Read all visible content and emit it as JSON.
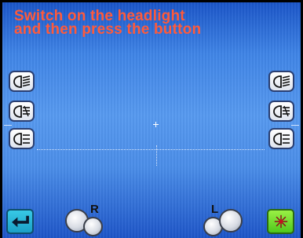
{
  "instruction": {
    "line1": "Switch on the headlight",
    "line2": "and then press the button"
  },
  "side_labels": {
    "right_side": "R",
    "left_side": "L"
  },
  "left_buttons": [
    {
      "icon": "high-beam-icon"
    },
    {
      "icon": "fog-light-icon"
    },
    {
      "icon": "low-beam-icon"
    }
  ],
  "right_buttons": [
    {
      "icon": "high-beam-icon"
    },
    {
      "icon": "fog-light-icon"
    },
    {
      "icon": "low-beam-icon"
    }
  ],
  "bottom_buttons": {
    "back": {
      "icon": "return-arrow-icon",
      "color": "#25b4d8"
    },
    "laser": {
      "icon": "laser-icon",
      "color": "#66d62a"
    }
  },
  "colors": {
    "instruction_text": "#ff5a3a",
    "background_top": "#1a55c8",
    "background_mid": "#5699ef"
  }
}
